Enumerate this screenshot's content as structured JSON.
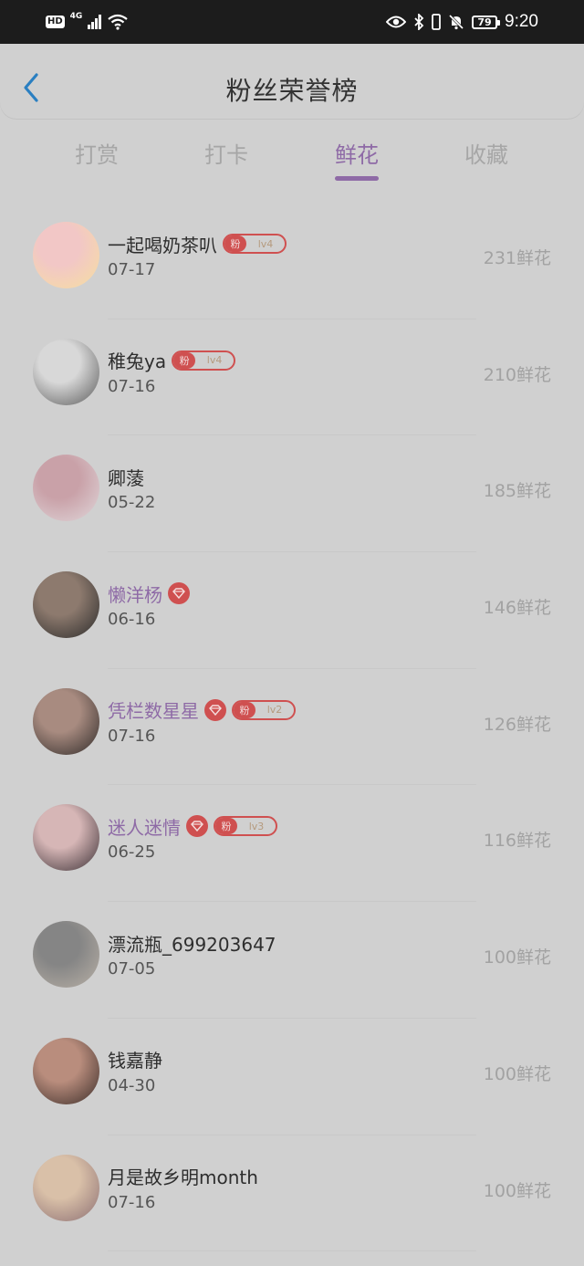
{
  "status_bar": {
    "hd": "HD",
    "network": "4G",
    "battery": "79",
    "time": "9:20"
  },
  "header": {
    "title": "粉丝荣誉榜"
  },
  "tabs": [
    {
      "label": "打赏",
      "active": false
    },
    {
      "label": "打卡",
      "active": false
    },
    {
      "label": "鲜花",
      "active": true
    },
    {
      "label": "收藏",
      "active": false
    }
  ],
  "fans": [
    {
      "name": "一起喝奶茶叭",
      "date": "07-17",
      "count": "231鲜花",
      "vip": false,
      "fan_badge": {
        "label": "粉",
        "level": "lv4"
      },
      "avatar_colors": [
        "#f6dfa0",
        "#f2c7c6"
      ]
    },
    {
      "name": "稚兔ya",
      "date": "07-16",
      "count": "210鲜花",
      "vip": false,
      "fan_badge": {
        "label": "粉",
        "level": "lv4"
      },
      "avatar_colors": [
        "#5a5a5a",
        "#d8d8d8"
      ]
    },
    {
      "name": "卿蔆",
      "date": "05-22",
      "count": "185鲜花",
      "vip": false,
      "fan_badge": null,
      "avatar_colors": [
        "#e0d7da",
        "#c9a1a8"
      ]
    },
    {
      "name": "懒洋杨",
      "date": "06-16",
      "count": "146鲜花",
      "vip": true,
      "fan_badge": null,
      "avatar_colors": [
        "#2a2a2a",
        "#8d7a6e"
      ]
    },
    {
      "name": "凭栏数星星",
      "date": "07-16",
      "count": "126鲜花",
      "vip": true,
      "fan_badge": {
        "label": "粉",
        "level": "lv2"
      },
      "avatar_colors": [
        "#2f2a28",
        "#a88b80"
      ]
    },
    {
      "name": "迷人迷情",
      "date": "06-25",
      "count": "116鲜花",
      "vip": true,
      "fan_badge": {
        "label": "粉",
        "level": "lv3"
      },
      "avatar_colors": [
        "#3b3035",
        "#d6b6b6"
      ]
    },
    {
      "name": "漂流瓶_699203647",
      "date": "07-05",
      "count": "100鲜花",
      "vip": false,
      "fan_badge": null,
      "avatar_colors": [
        "#b8b0a6",
        "#858585"
      ]
    },
    {
      "name": "钱嘉静",
      "date": "04-30",
      "count": "100鲜花",
      "vip": false,
      "fan_badge": null,
      "avatar_colors": [
        "#3a2c28",
        "#b98d7d"
      ]
    },
    {
      "name": "月是故乡明month",
      "date": "07-16",
      "count": "100鲜花",
      "vip": false,
      "fan_badge": null,
      "avatar_colors": [
        "#8c6f73",
        "#d9c0a8"
      ]
    }
  ],
  "colors": {
    "accent": "#8e6aa6",
    "badge_red": "#cf5050",
    "background": "#d0d0d0"
  }
}
